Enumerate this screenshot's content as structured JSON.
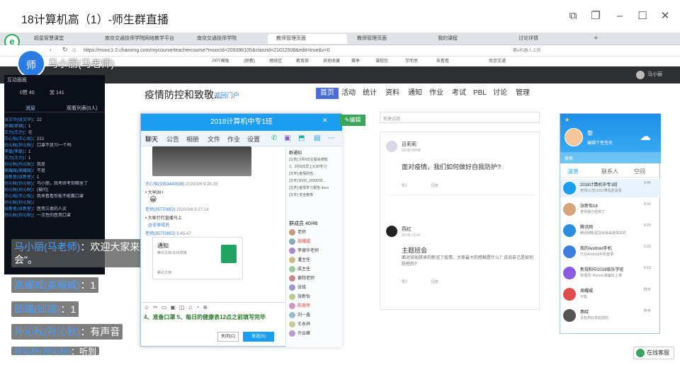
{
  "window": {
    "title": "18计算机高（1）-师生群直播"
  },
  "browser": {
    "tabs": [
      "超星智慧课堂",
      "南京交通技师学院网络教学平台",
      "南京交通技师学院",
      "教师管理页面",
      "教师管理页面",
      "我的课程",
      "讨论详情"
    ],
    "url": "https://mooc1-2.chaoxing.com/mycourse/teachercourse?moocId=209396105&clazzid=21022508&edit=true&v=0",
    "search_placeholder": "赛e机器人上岗",
    "bookmarks": [
      "PPT模板",
      "(职教)",
      "理财区",
      "教育部",
      "其他收藏",
      "赛季",
      "课程包",
      "学而思",
      "去看看",
      "南京交通"
    ]
  },
  "live": {
    "avatar_text": "师",
    "presenter": "马小丽(马老师)",
    "overlay": [
      {
        "name": "马小丽(马老师)",
        "text": "：欢迎大家来观看直播，\"3.6主题班会\"。"
      },
      {
        "name": "高耀威(高耀威)",
        "text": "：1"
      },
      {
        "name": "邱瑞(邱瑞)",
        "text": "：1"
      },
      {
        "name": "孙沁秋(孙沁秋)",
        "text": "：有声音"
      },
      {
        "name": "孙沁秋(孙沁秋)",
        "text": "：听到"
      }
    ]
  },
  "interaction_panel": {
    "title": "互动面板",
    "likes": "0赞 40",
    "gifts": "赏 141",
    "tabs": [
      "消息",
      "观看列表(0人)"
    ],
    "messages": [
      {
        "name": "张文华(张文华)",
        "text": "22"
      },
      {
        "name": "徐锦(徐锦)",
        "text": "1"
      },
      {
        "name": "王力(王力)",
        "text": "在"
      },
      {
        "name": "王心怡(王心怡)",
        "text": "222"
      },
      {
        "name": "孙沁秋(孙沁秋)",
        "text": "口罩不是70一个吗"
      },
      {
        "name": "李磊(李磊)",
        "text": "1"
      },
      {
        "name": "王力(王力)",
        "text": "1"
      },
      {
        "name": "孙沁秋(孙沁秋)",
        "text": "我是"
      },
      {
        "name": "高耀威(高耀威)",
        "text": "不是"
      },
      {
        "name": "张新星(张新星)",
        "text": "1"
      },
      {
        "name": "孙沁秋(孙沁秋)",
        "text": "马小丽，我考研考到哪里了"
      },
      {
        "name": "孙沁秋(孙沁秋)",
        "text": "(被问)"
      },
      {
        "name": "王心怡(王心怡)",
        "text": "我来看看你能不能戴口罩"
      },
      {
        "name": "孙沁秋(孙沁秋)",
        "text": ""
      },
      {
        "name": "张新星(张新星)",
        "text": "医用三类的人买"
      },
      {
        "name": "孙沁秋(孙沁秋)",
        "text": "一次性的医用口罩"
      }
    ]
  },
  "site": {
    "course_title": "疫情防控和致敬...",
    "course_sub": "返回门户",
    "nav": [
      "首页",
      "活动",
      "统计",
      "资料",
      "通知",
      "作业",
      "考试",
      "PBL",
      "讨论",
      "管理"
    ],
    "user": "马小丽"
  },
  "qq_group": {
    "title": "2018计算机中专1班",
    "tabs": [
      "聊天",
      "公告",
      "相册",
      "文件",
      "作业",
      "设置"
    ],
    "messages": [
      {
        "name": "王心怡(3353440638)",
        "time": "2020/3/6 9:26:29",
        "text": "• 大早99+"
      },
      {
        "name": "老师(35770853)",
        "time": "2020/3/6 9:27:14",
        "text": "• 大家打打直播马上"
      },
      {
        "name": "老师(35770853)",
        "time": "9:45:47",
        "text": "@全体成员"
      }
    ],
    "file_card": {
      "name": "通知",
      "source": "腾讯文档-在线表格",
      "footer": "腾讯文档"
    },
    "input_text": "4、准备口罩    5、每日的健康表12点之前填写完毕",
    "notice_title": "群通知",
    "notices": [
      "[公告] 3月6日主题会通知",
      "1、3月6日早上9:30学习",
      "[文件] 疫情防控...",
      "[文件] $VID_2020030...",
      "[文件] 疫情学习报告.docx",
      "[文件] 安全教育"
    ],
    "members_label": "群成员 40/46",
    "members": [
      "老师",
      "周耀威",
      "李德华老师",
      "潘主任",
      "成主任",
      "黄院老师",
      "张铭",
      "张新怡",
      "陈丽萍",
      "刘一鑫",
      "王永祥",
      "许云峰"
    ],
    "close_label": "关闭(C)",
    "send_label": "发送(S)"
  },
  "discussion": {
    "search_placeholder": "新建话题",
    "posts": [
      {
        "author": "吕莉莉",
        "date": "03-06 09:54",
        "title": "面对疫情，我们如何做好自我防护?",
        "body": "",
        "likes": "赞1",
        "replies": "回复"
      },
      {
        "author": "燕红",
        "date": "03-05 21:47",
        "title": "主题班会",
        "body": "面对突如其来的新冠了疫情，大家最大的感触是什么？说说自己是如何防控的?",
        "likes": "赞2",
        "replies": "回复"
      }
    ]
  },
  "qq_main": {
    "nickname": "黎",
    "signature": "编辑个性签名",
    "search_placeholder": "搜索",
    "tabs": [
      "消息",
      "联系人",
      "空间"
    ],
    "contacts": [
      {
        "name": "2018计算机中专1班",
        "msg": "老师(公告)18计算机赶紧看",
        "time": "9:45"
      },
      {
        "name": "张新怡18",
        "msg": "老师我已经到了",
        "time": "9:32"
      },
      {
        "name": "腾讯网",
        "msg": "腾讯网新型冠状病毒疫情实时",
        "time": "9:29"
      },
      {
        "name": "我的Android手机",
        "msg": "已在Android手机登录",
        "time": "9:21"
      },
      {
        "name": "新规和中2019级乐学班",
        "msg": "管理员: Romeo准备好上课",
        "time": "8:19"
      },
      {
        "name": "周耀威",
        "msg": "不能",
        "time": "昨天"
      },
      {
        "name": "燕晓",
        "msg": "没有想好发给您的",
        "time": "昨天"
      }
    ]
  },
  "helper": {
    "label": "在线客服"
  }
}
